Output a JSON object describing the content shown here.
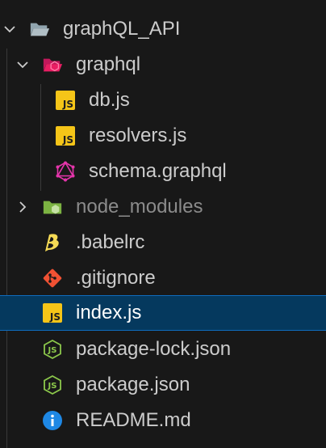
{
  "explorer": {
    "items": [
      {
        "label": "graphQL_API",
        "type": "folder-open",
        "icon": "folder-open-icon"
      },
      {
        "label": "graphql",
        "type": "folder-open",
        "icon": "graphql-folder-icon"
      },
      {
        "label": "db.js",
        "type": "file",
        "icon": "js-file-icon"
      },
      {
        "label": "resolvers.js",
        "type": "file",
        "icon": "js-file-icon"
      },
      {
        "label": "schema.graphql",
        "type": "file",
        "icon": "graphql-icon"
      },
      {
        "label": "node_modules",
        "type": "folder-closed",
        "icon": "node-folder-icon"
      },
      {
        "label": ".babelrc",
        "type": "file",
        "icon": "babel-icon"
      },
      {
        "label": ".gitignore",
        "type": "file",
        "icon": "git-icon"
      },
      {
        "label": "index.js",
        "type": "file",
        "icon": "js-file-icon",
        "selected": true
      },
      {
        "label": "package-lock.json",
        "type": "file",
        "icon": "nodejs-icon"
      },
      {
        "label": "package.json",
        "type": "file",
        "icon": "nodejs-icon"
      },
      {
        "label": "README.md",
        "type": "file",
        "icon": "info-icon"
      }
    ],
    "js_badge": "JS"
  },
  "colors": {
    "background": "#181818",
    "selected_row": "#05395e",
    "selected_border": "#0f6cbd",
    "js_yellow": "#f5c518",
    "graphql_pink": "#e535ab",
    "node_green": "#8cc84b",
    "git_orange": "#f05133",
    "babel_yellow": "#f5da55",
    "info_blue": "#1e88e5"
  }
}
